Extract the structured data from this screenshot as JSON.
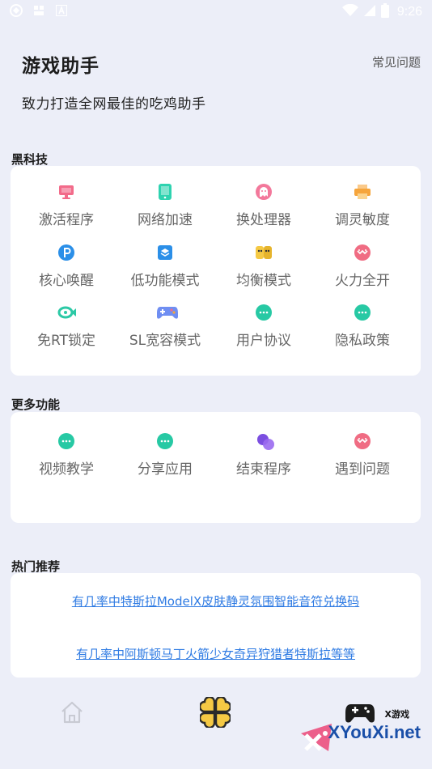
{
  "status_bar": {
    "time": "9:26"
  },
  "header": {
    "title": "游戏助手",
    "faq_link": "常见问题",
    "subtitle": "致力打造全网最佳的吃鸡助手"
  },
  "black_tech": {
    "title": "黑科技",
    "items": [
      {
        "label": "激活程序",
        "icon": "monitor-icon",
        "color": "#f26b8a"
      },
      {
        "label": "网络加速",
        "icon": "tablet-icon",
        "color": "#2ed3b0"
      },
      {
        "label": "换处理器",
        "icon": "ghost-icon",
        "color": "#f3789b"
      },
      {
        "label": "调灵敏度",
        "icon": "printer-icon",
        "color": "#f6a53b"
      },
      {
        "label": "核心唤醒",
        "icon": "p-icon",
        "color": "#2b8fe8"
      },
      {
        "label": "低功能模式",
        "icon": "layers-icon",
        "color": "#2b8fe8"
      },
      {
        "label": "均衡模式",
        "icon": "yellow-faces-icon",
        "color": "#f5c944"
      },
      {
        "label": "火力全开",
        "icon": "crab-icon",
        "color": "#f06c83"
      },
      {
        "label": "免RT锁定",
        "icon": "fish-icon",
        "color": "#2cc9a6"
      },
      {
        "label": "SL宽容模式",
        "icon": "gamepad-icon",
        "color": "#6f8ef2"
      },
      {
        "label": "用户协议",
        "icon": "chat-icon",
        "color": "#27c9a4"
      },
      {
        "label": "隐私政策",
        "icon": "chat-icon",
        "color": "#27c9a4"
      }
    ]
  },
  "more_functions": {
    "title": "更多功能",
    "items": [
      {
        "label": "视频教学",
        "icon": "chat-icon",
        "color": "#27c9a4"
      },
      {
        "label": "分享应用",
        "icon": "chat-icon",
        "color": "#27c9a4"
      },
      {
        "label": "结束程序",
        "icon": "circles-icon",
        "color": "#7b4ee0"
      },
      {
        "label": "遇到问题",
        "icon": "crab-icon",
        "color": "#f06c83"
      }
    ]
  },
  "hot": {
    "title": "热门推荐",
    "links": [
      "有几率中特斯拉ModelX皮肤静灵氛围智能音符兑换码",
      "有几率中阿斯顿马丁火箭少女奇异狩猎者特斯拉等等"
    ]
  },
  "watermark": {
    "small": "X游戏",
    "main": "XYouXi.net"
  }
}
